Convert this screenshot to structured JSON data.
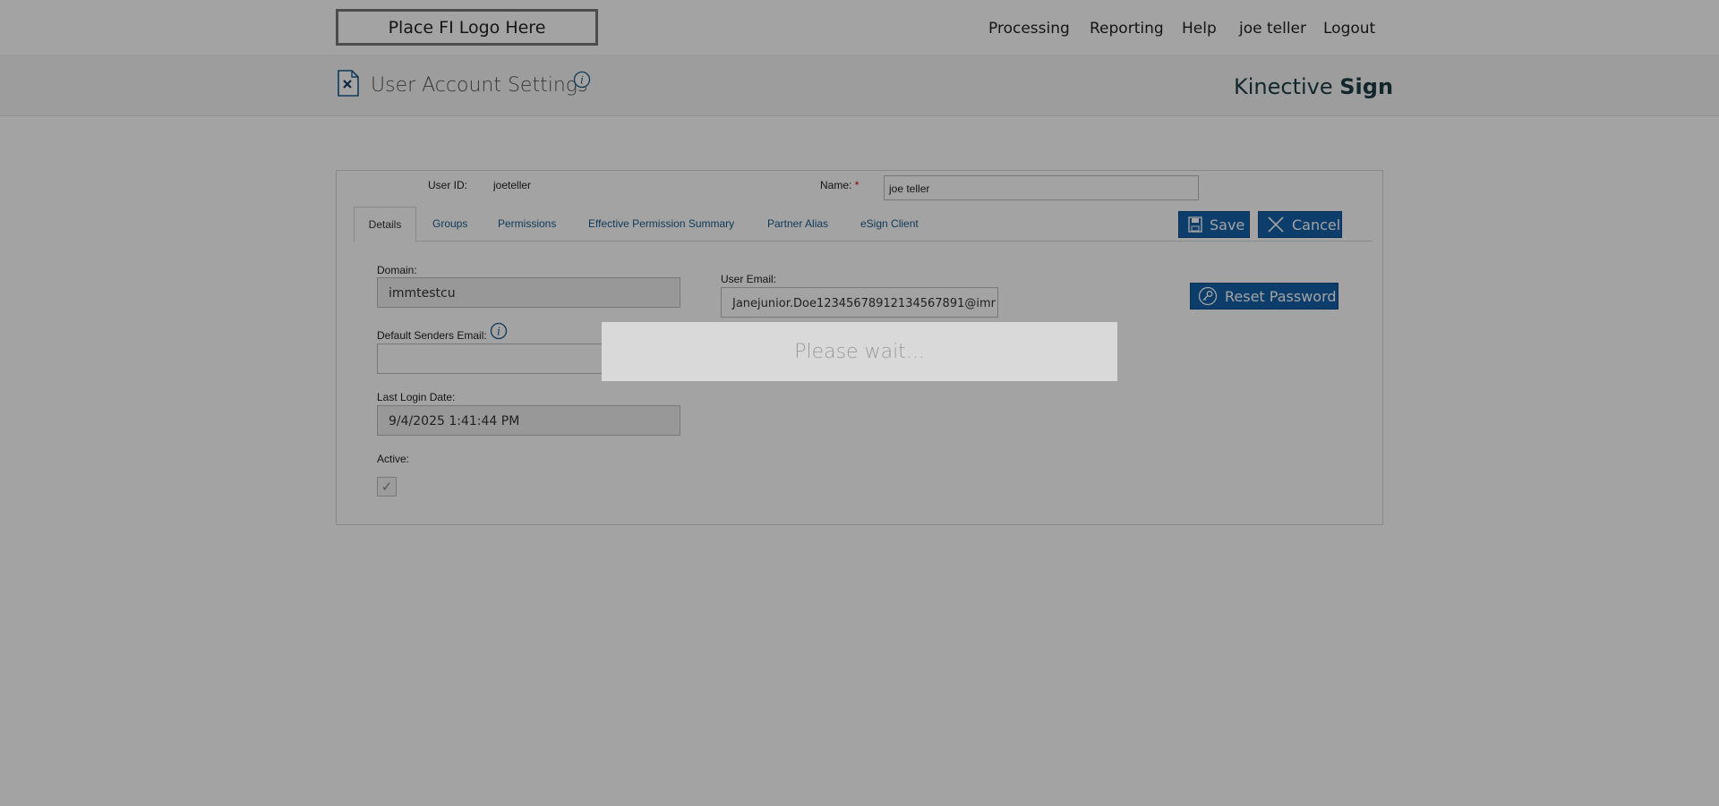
{
  "top_nav": {
    "logo_text": "Place FI Logo Here",
    "items": [
      {
        "label": "Processing"
      },
      {
        "label": "Reporting"
      },
      {
        "label": "Help"
      },
      {
        "label": "joe teller"
      },
      {
        "label": "Logout"
      }
    ]
  },
  "header": {
    "page_title": "User Account Settings",
    "page_icon": "document-x-icon",
    "info_icon": "info-icon",
    "brand_prefix": "Kinective",
    "brand_suffix": "Sign"
  },
  "user": {
    "user_id_label": "User ID:",
    "user_id": "joeteller",
    "name_label": "Name:",
    "required_mark": "*",
    "name_value": "joe teller"
  },
  "tabs": [
    {
      "label": "Details",
      "active": true
    },
    {
      "label": "Groups"
    },
    {
      "label": "Permissions"
    },
    {
      "label": "Effective Permission Summary"
    },
    {
      "label": "Partner Alias"
    },
    {
      "label": "eSign Client"
    }
  ],
  "actions": {
    "save_label": "Save",
    "cancel_label": "Cancel",
    "reset_password_label": "Reset Password"
  },
  "details": {
    "domain_label": "Domain:",
    "domain_value": "immtestcu",
    "default_senders_email_label": "Default Senders Email:",
    "default_senders_email_value": "",
    "last_login_label": "Last Login Date:",
    "last_login_value": "9/4/2025 1:41:44 PM",
    "active_label": "Active:",
    "active_checked": true,
    "user_email_label": "User Email:",
    "user_email_value": "Janejunior.Doe12345678912134567891@imr"
  },
  "overlay": {
    "message": "Please wait..."
  },
  "colors": {
    "accent": "#1360a8",
    "link": "#1a5a8a",
    "brand": "#1d3d45",
    "required": "#cc0000"
  }
}
